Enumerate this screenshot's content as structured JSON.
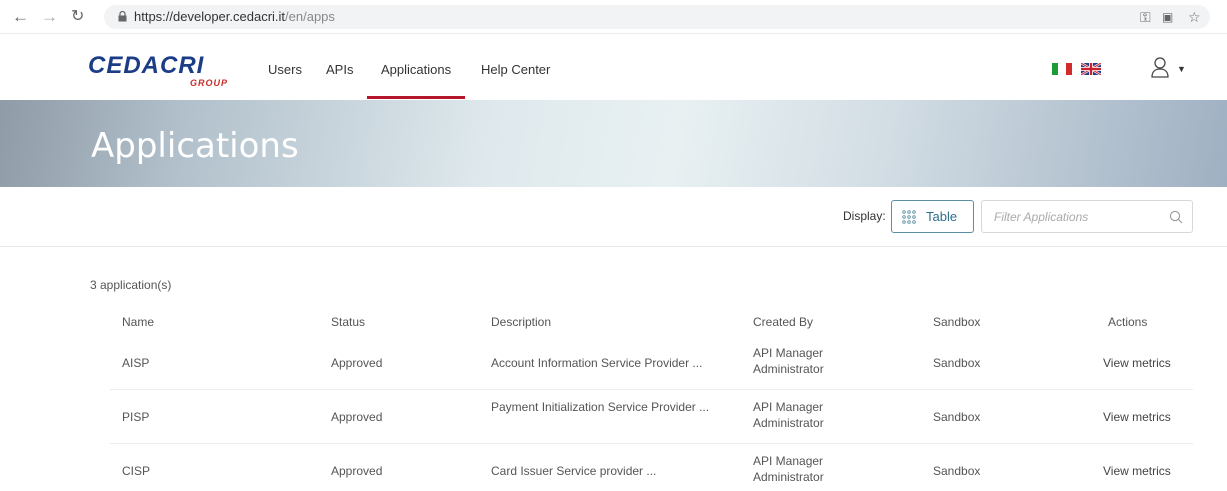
{
  "browser": {
    "url_host": "https://developer.cedacri.it",
    "url_path": "/en/apps",
    "icons": [
      "back-arrow-icon",
      "forward-arrow-icon",
      "reload-icon",
      "lock-icon",
      "key-icon",
      "translate-icon",
      "star-icon"
    ]
  },
  "header": {
    "logo_main": "CEDACRI",
    "logo_sub": "GROUP",
    "menu": [
      {
        "label": "Users"
      },
      {
        "label": "APIs"
      },
      {
        "label": "Applications",
        "active": true
      },
      {
        "label": "Help Center"
      }
    ],
    "languages": [
      "italian-flag-icon",
      "uk-flag-icon"
    ],
    "icons": [
      "user-icon",
      "caret-down-icon"
    ]
  },
  "banner": {
    "title": "Applications"
  },
  "toolbar": {
    "display_label": "Display:",
    "display_value": "Table",
    "filter_placeholder": "Filter Applications"
  },
  "table": {
    "count": "3 application(s)",
    "columns": [
      "Name",
      "Status",
      "Description",
      "Created By",
      "Sandbox",
      "Actions"
    ],
    "rows": [
      {
        "name": "AISP",
        "status": "Approved",
        "description": "Account Information Service Provider ...",
        "created_by_1": "API Manager",
        "created_by_2": "Administrator",
        "sandbox": "Sandbox",
        "action": "View metrics"
      },
      {
        "name": "PISP",
        "status": "Approved",
        "description": "Payment Initialization Service Provider ...",
        "created_by_1": "API Manager",
        "created_by_2": "Administrator",
        "sandbox": "Sandbox",
        "action": "View metrics"
      },
      {
        "name": "CISP",
        "status": "Approved",
        "description": "Card Issuer Service provider ...",
        "created_by_1": "API Manager",
        "created_by_2": "Administrator",
        "sandbox": "Sandbox",
        "action": "View metrics"
      }
    ]
  },
  "colors": {
    "accent": "#b5162b",
    "brand_blue": "#1b3c87",
    "brand_red": "#c62b2b",
    "button_border": "#5a8fa6"
  }
}
